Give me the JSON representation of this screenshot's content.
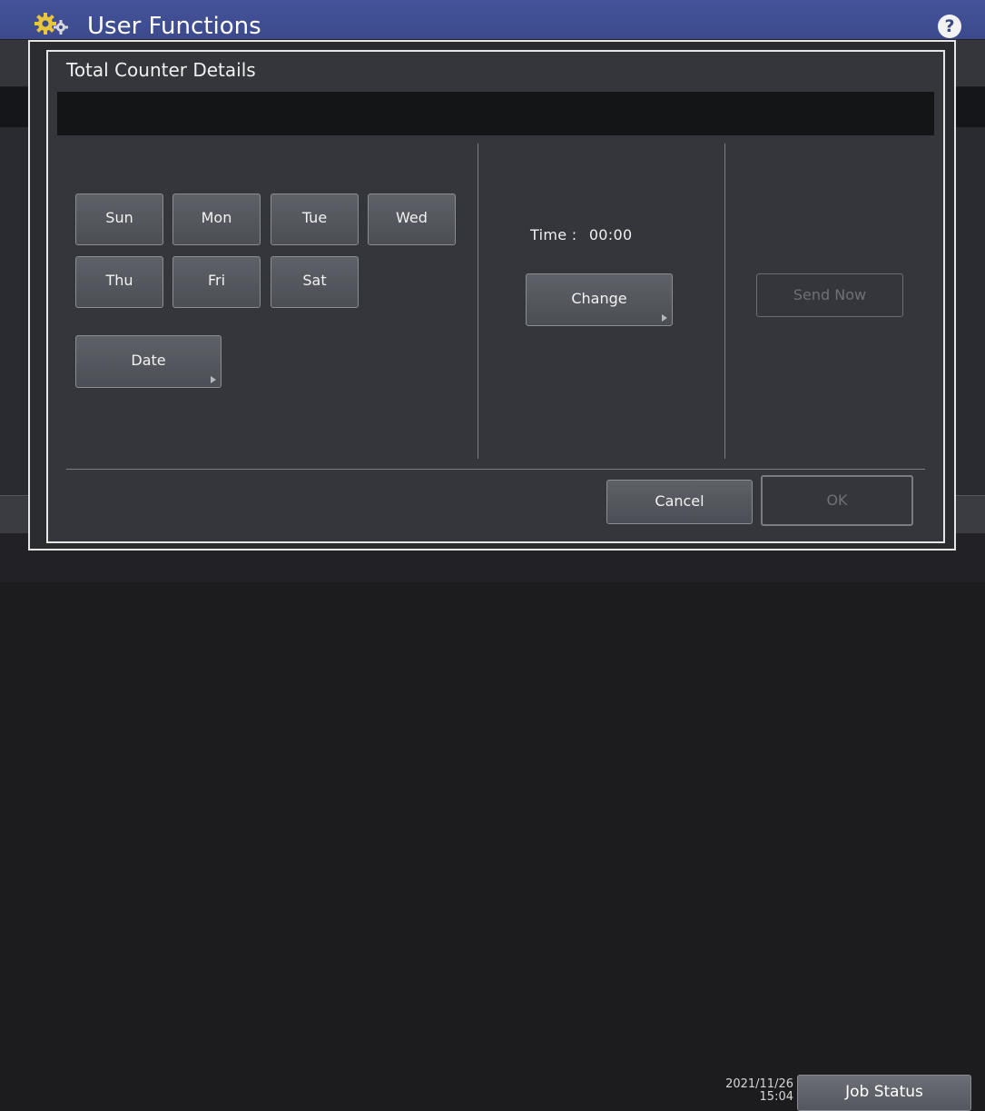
{
  "app": {
    "title": "User Functions",
    "help_label": "?",
    "job_status_label": "Job Status",
    "datetime": {
      "date": "2021/11/26",
      "time": "15:04"
    }
  },
  "dialog": {
    "title": "Total Counter Details",
    "days": [
      {
        "label": "Sun"
      },
      {
        "label": "Mon"
      },
      {
        "label": "Tue"
      },
      {
        "label": "Wed"
      },
      {
        "label": "Thu"
      },
      {
        "label": "Fri"
      },
      {
        "label": "Sat"
      }
    ],
    "date_button": "Date",
    "time_label": "Time :",
    "time_value": "00:00",
    "change_button": "Change",
    "send_now_button": "Send Now",
    "cancel_button": "Cancel",
    "ok_button": "OK"
  },
  "colors": {
    "header_bg": "#3c4a8c",
    "modal_bg": "#34363b",
    "button_bg": "#55575e"
  }
}
